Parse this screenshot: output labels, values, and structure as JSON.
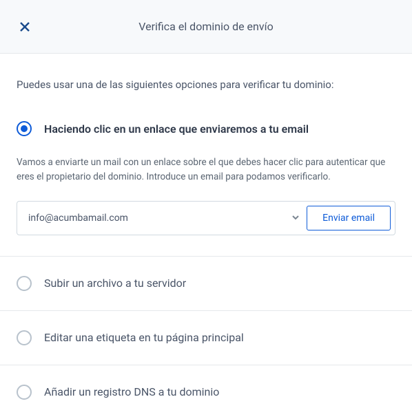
{
  "header": {
    "title": "Verifica el dominio de envío"
  },
  "intro": "Puedes usar una de las siguientes opciones para verificar tu dominio:",
  "options": {
    "email": {
      "label": "Haciendo clic en un enlace que enviaremos a tu email",
      "helper": "Vamos a enviarte un mail con un enlace sobre el que debes hacer clic para autenticar que eres el propietario del dominio. Introduce un email para podamos verificarlo.",
      "selectedEmail": "info@acumbamail.com",
      "sendButton": "Enviar email"
    },
    "upload": {
      "label": "Subir un archivo a tu servidor"
    },
    "tag": {
      "label": "Editar una etiqueta en tu página principal"
    },
    "dns": {
      "label": "Añadir un registro DNS a tu dominio"
    }
  }
}
